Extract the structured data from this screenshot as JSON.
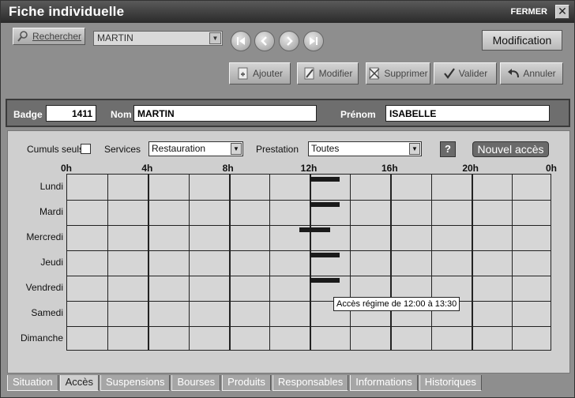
{
  "window": {
    "title": "Fiche individuelle",
    "close_label": "FERMER",
    "close_glyph": "✕"
  },
  "toolbar": {
    "search_label": "Rechercher",
    "name_value": "MARTIN",
    "modification_label": "Modification",
    "nav": [
      "first",
      "previous",
      "next",
      "last"
    ],
    "actions": {
      "add_label": "Ajouter",
      "edit_label": "Modifier",
      "delete_label": "Supprimer",
      "validate_label": "Valider",
      "cancel_label": "Annuler"
    }
  },
  "identity": {
    "badge_label": "Badge",
    "badge_value": "1411",
    "name_label": "Nom",
    "name_value": "MARTIN",
    "firstname_label": "Prénom",
    "firstname_value": "ISABELLE"
  },
  "filters": {
    "cumuls_label": "Cumuls seuls",
    "services_label": "Services",
    "services_value": "Restauration",
    "prestation_label": "Prestation",
    "prestation_value": "Toutes",
    "help_label": "?",
    "new_access_label": "Nouvel accès"
  },
  "schedule": {
    "hour_labels": [
      "0h",
      "4h",
      "8h",
      "12h",
      "16h",
      "20h",
      "0h"
    ],
    "days": [
      "Lundi",
      "Mardi",
      "Mercredi",
      "Jeudi",
      "Vendredi",
      "Samedi",
      "Dimanche"
    ],
    "accesses": [
      {
        "day": 0,
        "start": 12.0,
        "end": 13.5
      },
      {
        "day": 1,
        "start": 12.0,
        "end": 13.5
      },
      {
        "day": 2,
        "start": 11.5,
        "end": 13.0
      },
      {
        "day": 3,
        "start": 12.0,
        "end": 13.5
      },
      {
        "day": 4,
        "start": 12.0,
        "end": 13.5
      }
    ],
    "tooltip": "Accès régime de 12:00 à 13:30"
  },
  "tabs": [
    {
      "label": "Situation",
      "active": false
    },
    {
      "label": "Accès",
      "active": true
    },
    {
      "label": "Suspensions",
      "active": false
    },
    {
      "label": "Bourses",
      "active": false
    },
    {
      "label": "Produits",
      "active": false
    },
    {
      "label": "Responsables",
      "active": false
    },
    {
      "label": "Informations",
      "active": false
    },
    {
      "label": "Historiques",
      "active": false
    }
  ]
}
